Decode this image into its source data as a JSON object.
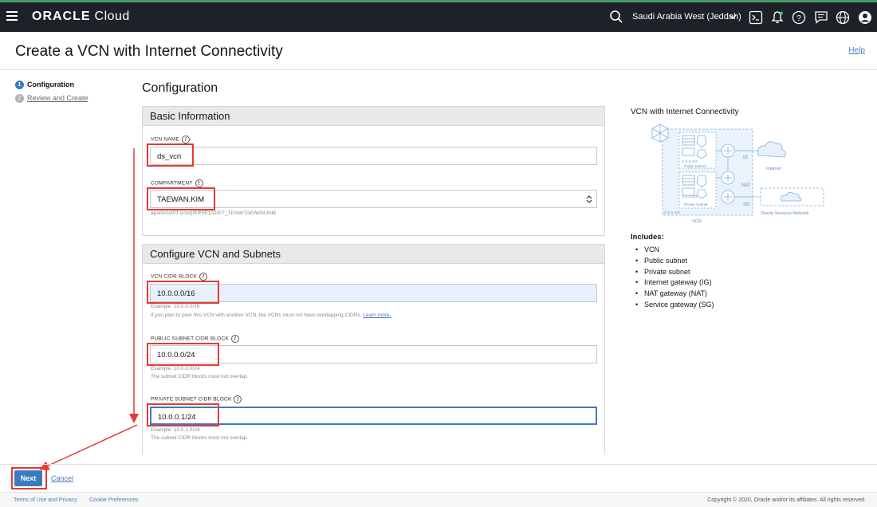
{
  "topbar": {
    "brand_bold": "ORACLE",
    "brand_rest": " Cloud",
    "region": "Saudi Arabia West (Jeddah)",
    "icons": [
      "menu-icon",
      "search-icon",
      "chevron-down-icon",
      "cloud-shell-icon",
      "bell-icon",
      "help-icon",
      "chat-icon",
      "globe-icon",
      "user-icon"
    ]
  },
  "header": {
    "title": "Create a VCN with Internet Connectivity",
    "help": "Help"
  },
  "steps": [
    {
      "num": "1",
      "label": "Configuration"
    },
    {
      "num": "2",
      "label": "Review and Create"
    }
  ],
  "section_title": "Configuration",
  "basic": {
    "heading": "Basic Information",
    "vcn_name_label": "VCN NAME",
    "vcn_name_value": "ds_vcn",
    "compartment_label": "COMPARTMENT",
    "compartment_value": "TAEWAN.KIM",
    "compartment_path": "apackrsct01 (root)/KRSE102/ET_TEAM/TAEWAN.KIM"
  },
  "subnets": {
    "heading": "Configure VCN and Subnets",
    "vcn_cidr_label": "VCN CIDR BLOCK",
    "vcn_cidr_value": "10.0.0.0/16",
    "vcn_cidr_example": "Example: 10.0.0.0/16",
    "vcn_cidr_note": "If you plan to peer this VCN with another VCN, the VCNs must not have overlapping CIDRs.",
    "learn_more": "Learn more.",
    "public_label": "PUBLIC SUBNET CIDR BLOCK",
    "public_value": "10.0.0.0/24",
    "public_example": "Example: 10.0.0.0/24",
    "public_note": "The subnet CIDR blocks must not overlap.",
    "private_label": "PRIVATE SUBNET CIDR BLOCK",
    "private_value": "10.0.0.1/24",
    "private_example": "Example: 10.0.1.0/24",
    "private_note": "The subnet CIDR blocks must not overlap."
  },
  "diagram": {
    "title": "VCN with Internet Connectivity",
    "public_subnet": "Public Subnet",
    "private_subnet": "Private Subnet",
    "cidr_small": "X.X.X.X/X",
    "vcn": "VCN",
    "ig": "IG",
    "nat": "NAT",
    "sg": "SG",
    "internet": "Internet",
    "osn": "Oracle Services Network"
  },
  "includes": {
    "title": "Includes:",
    "items": [
      "VCN",
      "Public subnet",
      "Private subnet",
      "Internet gateway (IG)",
      "NAT gateway (NAT)",
      "Service gateway (SG)"
    ]
  },
  "actions": {
    "next": "Next",
    "cancel": "Cancel"
  },
  "footer": {
    "terms": "Terms of Use and Privacy",
    "cookies": "Cookie Preferences",
    "copyright": "Copyright © 2020, Oracle and/or its affiliates. All rights reserved."
  },
  "colors": {
    "topbar": "#1c2228",
    "accent": "#3b7bbf",
    "annotation": "#e53935"
  }
}
